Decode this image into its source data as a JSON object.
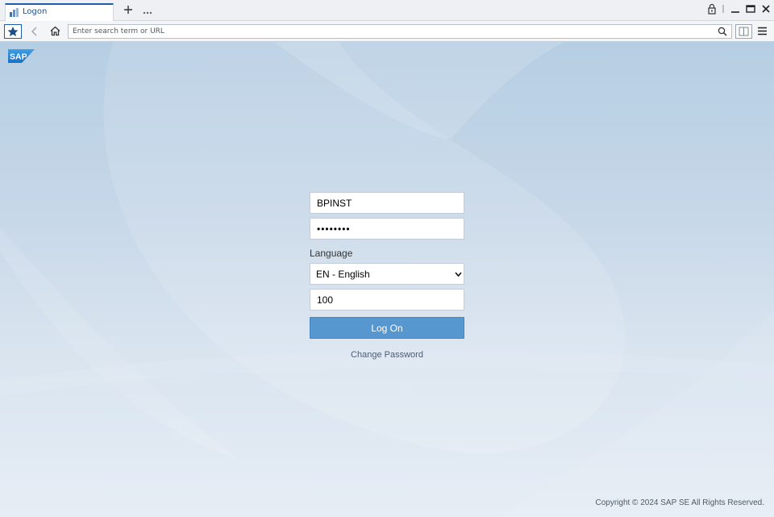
{
  "browser": {
    "tab_title": "Logon",
    "url_placeholder": "Enter search term or URL"
  },
  "page": {
    "logo_text": "SAP",
    "form": {
      "user": "BPINST",
      "password_masked": "••••••••",
      "language_label": "Language",
      "language_selected": "EN - English",
      "client": "100",
      "logon_label": "Log On",
      "change_password_label": "Change Password"
    },
    "copyright": "Copyright © 2024 SAP SE All Rights Reserved."
  },
  "colors": {
    "logon_button": "#5797d0",
    "tab_accent": "#1e5ea8",
    "sap_logo_blue": "#1a73c8"
  },
  "icons": [
    "tab-favicon-icon",
    "plus-icon",
    "more-dots-icon",
    "lock-icon",
    "minimize-icon",
    "maximize-icon",
    "close-icon",
    "star-icon",
    "back-arrow-icon",
    "home-icon",
    "search-icon",
    "sidebar-panel-icon",
    "hamburger-menu-icon",
    "chevron-down-icon"
  ]
}
